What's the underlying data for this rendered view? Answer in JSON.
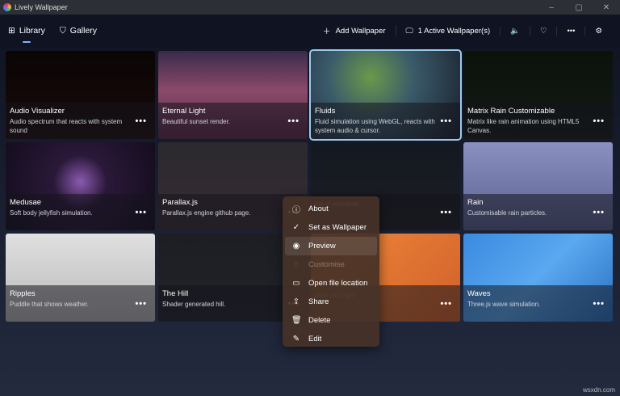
{
  "window": {
    "title": "Lively Wallpaper",
    "controls": [
      "–",
      "▢",
      "✕"
    ]
  },
  "nav": {
    "tabs": [
      {
        "label": "Library",
        "icon": "grid-icon",
        "active": true
      },
      {
        "label": "Gallery",
        "icon": "bag-icon"
      }
    ],
    "add_wallpaper": "Add Wallpaper",
    "active_wallpapers": "1 Active Wallpaper(s)"
  },
  "cards": [
    {
      "title": "Audio Visualizer",
      "desc": "Audio spectrum that reacts with system sound",
      "bg": "linear-gradient(180deg,#0a0505,#1a0a0a)"
    },
    {
      "title": "Eternal Light",
      "desc": "Beautiful sunset render.",
      "bg": "linear-gradient(180deg,#3b2a4a,#8a4a6a 45%,#5a2a4a)"
    },
    {
      "title": "Fluids",
      "desc": "Fluid simulation using WebGL, reacts with system audio & cursor.",
      "bg": "radial-gradient(circle at 40% 30%,#6a9a4a,#3a5a6a 40%,#1a1e2a)",
      "selected": true
    },
    {
      "title": "Matrix Rain Customizable",
      "desc": "Matrix like rain animation using HTML5 Canvas.",
      "bg": "linear-gradient(180deg,#0a120a,#141a16)"
    },
    {
      "title": "Medusae",
      "desc": "Soft body jellyfish simulation.",
      "bg": "radial-gradient(circle at 50% 45%,#8a5ab0,#2a1838 30%,#120c1c)"
    },
    {
      "title": "Parallax.js",
      "desc": "Parallax.js engine github page.",
      "bg": "linear-gradient(180deg,#2a2a2e,#3a2a34)"
    },
    {
      "title": "",
      "desc": "ble of elements.",
      "bg": "linear-gradient(180deg,#141820,#1c1e24)"
    },
    {
      "title": "Rain",
      "desc": "Customisable rain particles.",
      "bg": "linear-gradient(180deg,#8a90c0,#5a6090)"
    },
    {
      "title": "Ripples",
      "desc": "Puddle that shows weather.",
      "bg": "linear-gradient(180deg,#e0e0e0,#b8b8b8)"
    },
    {
      "title": "The Hill",
      "desc": "Shader generated hill.",
      "bg": "linear-gradient(180deg,#1c1e22,#22232a)"
    },
    {
      "title": "",
      "desc": "rator with light",
      "bg": "linear-gradient(135deg,#f08a3a,#d0602a)"
    },
    {
      "title": "Waves",
      "desc": "Three.js wave simulation.",
      "bg": "linear-gradient(135deg,#3a8ae0,#5aa8f0 50%,#2a70c0)"
    }
  ],
  "more_label": "•••",
  "context_menu": [
    {
      "label": "About",
      "icon": "ⓘ"
    },
    {
      "label": "Set as Wallpaper",
      "icon": "✓"
    },
    {
      "label": "Preview",
      "icon": "◉",
      "highlighted": true
    },
    {
      "label": "Customise",
      "icon": "◌",
      "disabled": true
    },
    {
      "label": "Open file location",
      "icon": "▭"
    },
    {
      "label": "Share",
      "icon": "⇪"
    },
    {
      "label": "Delete",
      "icon": "🗑"
    },
    {
      "label": "Edit",
      "icon": "✎"
    }
  ],
  "watermark": "wsxdn.com"
}
